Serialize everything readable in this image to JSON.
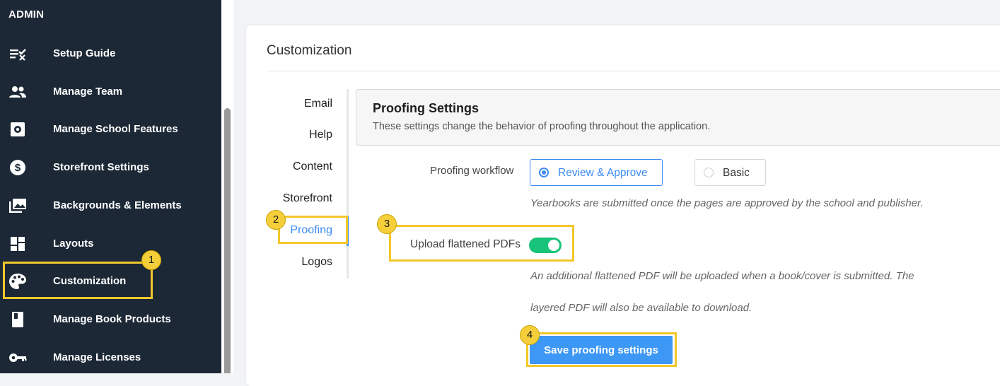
{
  "sidebar": {
    "section_title": "ADMIN",
    "items": [
      {
        "label": "Setup Guide",
        "icon": "checklist-icon"
      },
      {
        "label": "Manage Team",
        "icon": "people-icon"
      },
      {
        "label": "Manage School Features",
        "icon": "gear-box-icon"
      },
      {
        "label": "Storefront Settings",
        "icon": "dollar-circle-icon"
      },
      {
        "label": "Backgrounds & Elements",
        "icon": "images-icon"
      },
      {
        "label": "Layouts",
        "icon": "dashboard-icon"
      },
      {
        "label": "Customization",
        "icon": "palette-icon"
      },
      {
        "label": "Manage Book Products",
        "icon": "book-icon"
      },
      {
        "label": "Manage Licenses",
        "icon": "key-icon"
      }
    ]
  },
  "page": {
    "title": "Customization"
  },
  "subnav": {
    "items": [
      "Email",
      "Help",
      "Content",
      "Storefront",
      "Proofing",
      "Logos"
    ],
    "active": "Proofing"
  },
  "panel": {
    "title": "Proofing Settings",
    "subtitle": "These settings change the behavior of proofing throughout the application."
  },
  "form": {
    "workflow_label": "Proofing workflow",
    "workflow_options": [
      "Review & Approve",
      "Basic"
    ],
    "workflow_selected": "Review & Approve",
    "workflow_help": "Yearbooks are submitted once the pages are approved by the school and publisher.",
    "upload_label": "Upload flattened PDFs",
    "upload_enabled": true,
    "upload_help_line1": "An additional flattened PDF will be uploaded when a book/cover is submitted. The",
    "upload_help_line2": "layered PDF will also be available to download.",
    "save_label": "Save proofing settings"
  },
  "annotations": {
    "badges": [
      "1",
      "2",
      "3",
      "4"
    ]
  },
  "colors": {
    "sidebar_bg": "#1c2836",
    "accent": "#3d8bf0",
    "toggle_on": "#18c37a",
    "highlight": "#f3c72a"
  }
}
